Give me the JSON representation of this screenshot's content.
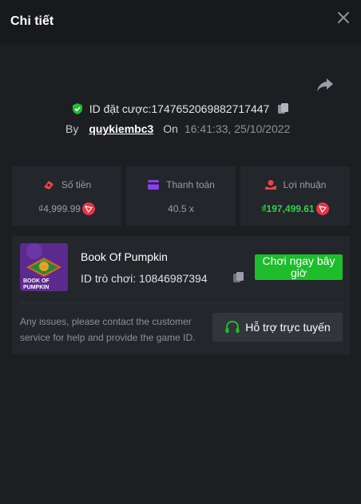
{
  "header": {
    "title": "Chi tiết"
  },
  "bet": {
    "id_label": "ID đặt cược: ",
    "id_value": "1747652069882717447",
    "by_label": "By",
    "username": "quykiembc3",
    "on_label": "On",
    "timestamp": "16:41:33, 25/10/2022"
  },
  "stats": [
    {
      "label": "Số tiền",
      "value": "₫4,999.99",
      "icon": "money-icon",
      "coin": "tron-coin-icon"
    },
    {
      "label": "Thanh toán",
      "value": "40.5 x",
      "icon": "card-icon"
    },
    {
      "label": "Lợi nhuận",
      "value": "₫197,499.61",
      "icon": "profit-icon",
      "coin": "tron-coin-icon"
    }
  ],
  "game": {
    "name": "Book Of Pumpkin",
    "id_label": "ID trò chơi: ",
    "id_value": "10846987394",
    "thumb_line1": "BOOK OF",
    "thumb_line2": "PUMPKIN",
    "play_label": "Chơi ngay bây giờ"
  },
  "help": {
    "text": "Any issues, please contact the customer service for help and provide the game ID.",
    "support_label": "Hỗ trợ trực tuyến"
  },
  "colors": {
    "accent_green": "#1ebd2c",
    "profit_green": "#33d14a",
    "icon_red": "#e8434a",
    "icon_purple": "#8a3ff0",
    "coin_red": "#e8344a"
  }
}
